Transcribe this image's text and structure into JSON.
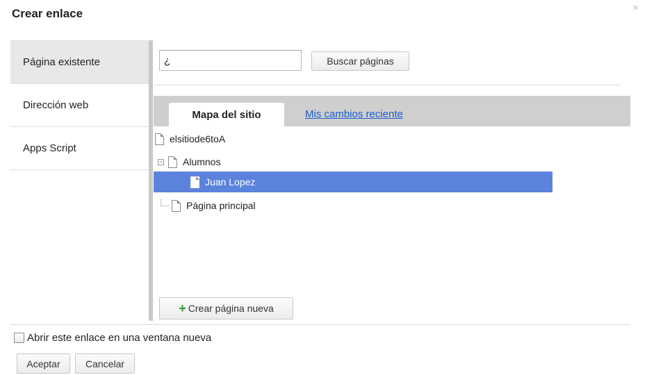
{
  "dialog": {
    "title": "Crear enlace",
    "close_glyph": "×"
  },
  "left_tabs": [
    {
      "label": "Página existente",
      "active": true
    },
    {
      "label": "Dirección web",
      "active": false
    },
    {
      "label": "Apps Script",
      "active": false
    }
  ],
  "search": {
    "value": "¿",
    "button_label": "Buscar páginas"
  },
  "tabs": {
    "sitemap": "Mapa del sitio",
    "recent": "Mis cambios reciente"
  },
  "tree": [
    {
      "label": "elsitiode6toA",
      "level": 0,
      "toggle": "",
      "selected": false
    },
    {
      "label": "Alumnos",
      "level": 1,
      "toggle": "−",
      "selected": false
    },
    {
      "label": "Juan Lopez",
      "level": 2,
      "toggle": "",
      "selected": true
    },
    {
      "label": "Página principal",
      "level": 1,
      "toggle": "",
      "selected": false
    }
  ],
  "new_page_button": "Crear página nueva",
  "open_new_window_checkbox": {
    "label": "Abrir este enlace en una ventana nueva",
    "checked": false
  },
  "buttons": {
    "accept": "Aceptar",
    "cancel": "Cancelar"
  },
  "colors": {
    "selection": "#5b83dc",
    "link": "#1a5ccf",
    "tab_bar": "#cfcfcf",
    "plus": "#2e9b2e"
  },
  "icons": {
    "page": "document-icon",
    "collapse": "tree-collapse-icon",
    "add": "plus-icon"
  }
}
